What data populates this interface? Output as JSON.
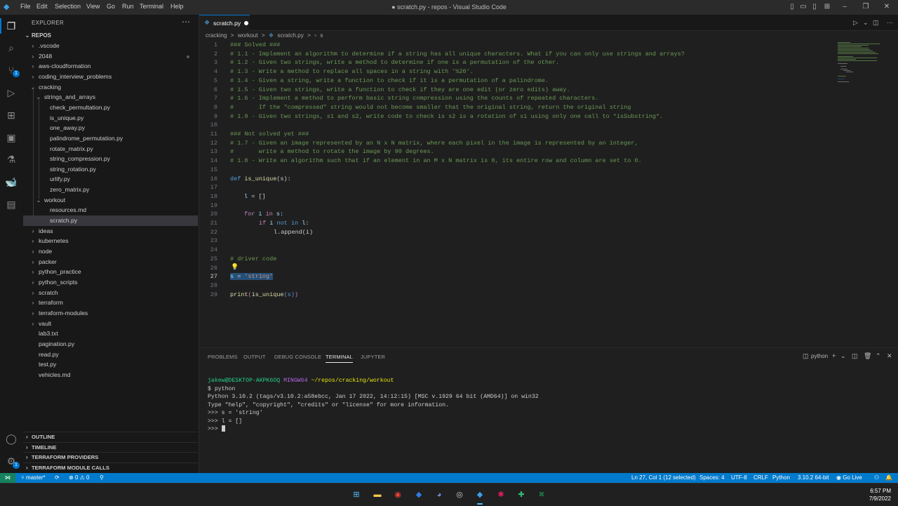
{
  "window": {
    "title": "● scratch.py - repos - Visual Studio Code",
    "menu": [
      "File",
      "Edit",
      "Selection",
      "View",
      "Go",
      "Run",
      "Terminal",
      "Help"
    ]
  },
  "activity_bar": {
    "items": [
      "explorer-icon",
      "search-icon",
      "source-control-icon",
      "run-debug-icon",
      "extensions-icon",
      "remote-explorer-icon",
      "testing-icon",
      "docker-icon",
      "terminal-icon"
    ],
    "scm_badge": "1",
    "settings_badge": "1"
  },
  "sidebar": {
    "title": "EXPLORER",
    "root": "REPOS",
    "tree": [
      {
        "label": ".vscode",
        "type": "folder",
        "open": false
      },
      {
        "label": "2048",
        "type": "folder",
        "open": false
      },
      {
        "label": "aws-cloudformation",
        "type": "folder",
        "open": false
      },
      {
        "label": "coding_interview_problems",
        "type": "folder",
        "open": false
      },
      {
        "label": "cracking",
        "type": "folder",
        "open": true
      },
      {
        "label": "strings_and_arrays",
        "type": "folder",
        "open": true
      },
      {
        "label": "check_permultation.py",
        "type": "file"
      },
      {
        "label": "is_unique.py",
        "type": "file"
      },
      {
        "label": "one_away.py",
        "type": "file"
      },
      {
        "label": "palindrome_permutation.py",
        "type": "file"
      },
      {
        "label": "rotate_matrix.py",
        "type": "file"
      },
      {
        "label": "string_compression.py",
        "type": "file"
      },
      {
        "label": "string_rotation.py",
        "type": "file"
      },
      {
        "label": "urlify.py",
        "type": "file"
      },
      {
        "label": "zero_matrix.py",
        "type": "file"
      },
      {
        "label": "workout",
        "type": "folder",
        "open": true
      },
      {
        "label": "resources.md",
        "type": "file"
      },
      {
        "label": "scratch.py",
        "type": "file",
        "selected": true
      },
      {
        "label": "ideas",
        "type": "folder",
        "open": false
      },
      {
        "label": "kubernetes",
        "type": "folder",
        "open": false
      },
      {
        "label": "node",
        "type": "folder",
        "open": false
      },
      {
        "label": "packer",
        "type": "folder",
        "open": false
      },
      {
        "label": "python_practice",
        "type": "folder",
        "open": false
      },
      {
        "label": "python_scripts",
        "type": "folder",
        "open": false
      },
      {
        "label": "scratch",
        "type": "folder",
        "open": false
      },
      {
        "label": "terraform",
        "type": "folder",
        "open": false
      },
      {
        "label": "terraform-modules",
        "type": "folder",
        "open": false
      },
      {
        "label": "vault",
        "type": "folder",
        "open": false
      },
      {
        "label": "lab3.txt",
        "type": "file"
      },
      {
        "label": "pagination.py",
        "type": "file"
      },
      {
        "label": "read.py",
        "type": "file"
      },
      {
        "label": "test.py",
        "type": "file"
      },
      {
        "label": "vehicles.md",
        "type": "file"
      }
    ],
    "sections": [
      "OUTLINE",
      "TIMELINE",
      "TERRAFORM PROVIDERS",
      "TERRAFORM MODULE CALLS"
    ]
  },
  "editor": {
    "tab_label": "scratch.py",
    "breadcrumb": [
      "cracking",
      ">",
      "workout",
      ">",
      "scratch.py",
      ">",
      "s"
    ],
    "current_line": "27"
  },
  "code": {
    "l1": "### Solved ###",
    "l2": "# 1.1 - Implement an algorithm to determine if a string has all unique characters. What if you can only use strings and arrays?",
    "l3": "# 1.2 - Given two strings, write a method to determine if one is a permutation of the other.",
    "l4": "# 1.3 - Write a method to replace all spaces in a string with '%20'.",
    "l5": "# 1.4 - Given a string, write a function to check if it is a permutation of a palindrome.",
    "l6": "# 1.5 - Given two strings, write a function to check if they are one edit (or zero edits) away.",
    "l7": "# 1.6 - Implement a method to perform basic string compression using the counts of repeated characters.",
    "l8": "#       If the \"compressed\" string would not become smaller that the original string, return the original string",
    "l9": "# 1.9 - Given two strings, s1 and s2, write code to check is s2 is a rotation of s1 using only one call to *isSubstring*.",
    "l11": "### Not solved yet ###",
    "l12": "# 1.7 - Given an image represented by an N x N matrix, where each pixel in the image is represented by an integer,",
    "l13": "#       write a method to rotate the image by 90 degrees.",
    "l14": "# 1.8 - Write an algorithm such that if an element in an M x N matrix is 0, its entire row and column are set to 0.",
    "kw_def": "def",
    "fn_name": "is_unique",
    "l16_rest": "(s):",
    "l18_var": "l",
    "l18_rest": " = []",
    "kw_for": "for",
    "l20_i": " i ",
    "kw_in": "in",
    "l20_s": " s:",
    "kw_if": "if",
    "l21_i": " i ",
    "kw_not": "not",
    "kw_in2": "in",
    "l21_l": " l:",
    "l22_code": "l.append(i)",
    "l25": "# driver code",
    "l27_var": "s",
    "l27_eq": " = ",
    "l27_str": "'string'",
    "l29_fn": "print",
    "l29_p1": "(",
    "l29_fn2": "is_unique",
    "l29_p2": "(s)",
    "l29_p3": ")"
  },
  "panel": {
    "tabs": [
      "PROBLEMS",
      "OUTPUT",
      "DEBUG CONSOLE",
      "TERMINAL",
      "JUPYTER"
    ],
    "terminal_name": "python",
    "lines": {
      "prompt_user": "jakew@DESKTOP-AKPK6OQ",
      "prompt_env": "MINGW64",
      "prompt_path": "~/repos/cracking/workout",
      "cmd": "$ python",
      "l3": "Python 3.10.2 (tags/v3.10.2:a58ebcc, Jan 17 2022, 14:12:15) [MSC v.1929 64 bit (AMD64)] on win32",
      "l4": "Type \"help\", \"copyright\", \"credits\" or \"license\" for more information.",
      "l5": ">>> s = 'string'",
      "l6": ">>> l = []",
      "l7": ">>> "
    }
  },
  "status_bar": {
    "branch": "master*",
    "errors": "0",
    "warnings": "0",
    "position": "Ln 27, Col 1 (12 selected)",
    "spaces": "Spaces: 4",
    "encoding": "UTF-8",
    "eol": "CRLF",
    "language": "Python",
    "interpreter": "3.10.2 64-bit",
    "live": "Go Live"
  },
  "taskbar": {
    "time": "6:57 PM",
    "date": "7/9/2022"
  },
  "colors": {
    "accent": "#0078d4",
    "status_bar": "#007acc",
    "comment": "#6a9955",
    "keyword": "#c586c0"
  }
}
